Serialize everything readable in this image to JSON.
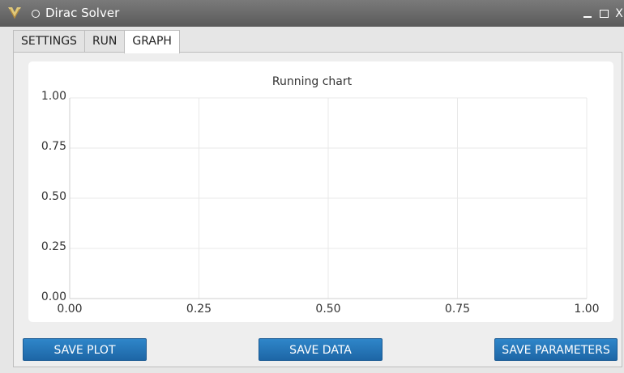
{
  "window": {
    "title": "Dirac Solver",
    "close_glyph": "X"
  },
  "tabs": [
    {
      "label": "SETTINGS",
      "active": false
    },
    {
      "label": "RUN",
      "active": false
    },
    {
      "label": "GRAPH",
      "active": true
    }
  ],
  "chart_data": {
    "type": "line",
    "title": "Running chart",
    "xlabel": "",
    "ylabel": "",
    "xlim": [
      0,
      1
    ],
    "ylim": [
      0,
      1
    ],
    "x_ticks": [
      "0.00",
      "0.25",
      "0.50",
      "0.75",
      "1.00"
    ],
    "y_ticks": [
      "0.00",
      "0.25",
      "0.50",
      "0.75",
      "1.00"
    ],
    "grid": true,
    "series": []
  },
  "buttons": {
    "save_plot": "SAVE PLOT",
    "save_data": "SAVE DATA",
    "save_parameters": "SAVE PARAMETERS"
  },
  "colors": {
    "button": "#2176b8",
    "grid": "#e8e8e8",
    "titlebar": "#666666"
  },
  "icons": {
    "app_logo": "app-logo-icon",
    "window_menu": "circle-icon",
    "minimize": "minimize-icon",
    "maximize": "maximize-icon",
    "close": "close-icon"
  }
}
